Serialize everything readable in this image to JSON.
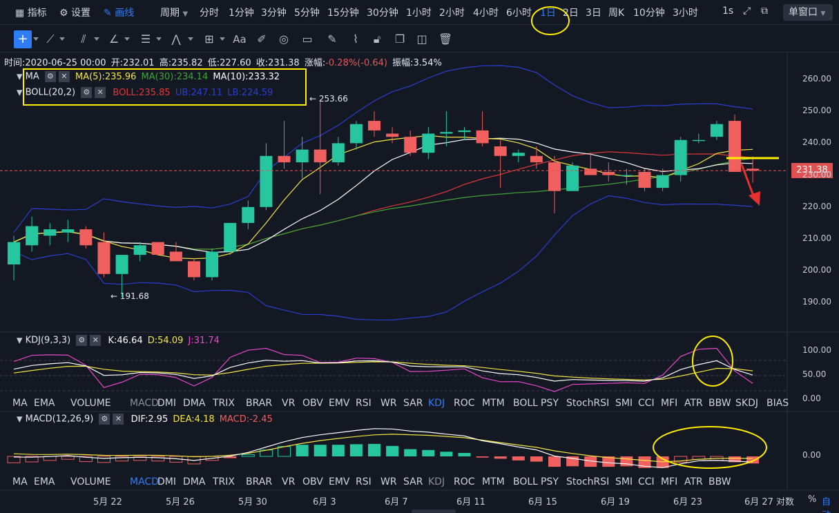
{
  "topbar": {
    "items": [
      {
        "key": "indicator",
        "label": "指标"
      },
      {
        "key": "settings",
        "label": "设置"
      },
      {
        "key": "draw",
        "label": "画线"
      },
      {
        "key": "period",
        "label": "周期"
      }
    ],
    "periods": [
      "分时",
      "1分钟",
      "3分钟",
      "5分钟",
      "15分钟",
      "30分钟",
      "1小时",
      "2小时",
      "4小时",
      "6小时",
      "1日",
      "2日",
      "3日",
      "周K",
      "10分钟",
      "3小时"
    ],
    "active_period": "1日",
    "refresh": "1s",
    "window_mode": "单窗口"
  },
  "info": {
    "time_label": "时间:",
    "time": "2020-06-25 00:00",
    "open_label": "开:",
    "open": "232.01",
    "high_label": "高:",
    "high": "235.82",
    "low_label": "低:",
    "low": "227.60",
    "close_label": "收:",
    "close": "231.38",
    "change_label": "涨幅:",
    "change": "-0.28%(-0.64)",
    "amp_label": "振幅:",
    "amp": "3.54%"
  },
  "ma_legend": {
    "name": "MA",
    "ma5": "MA(5):235.96",
    "ma30": "MA(30):234.14",
    "ma10": "MA(10):233.32"
  },
  "boll_legend": {
    "name": "BOLL(20,2)",
    "boll": "BOLL:235.85",
    "ub": "UB:247.11",
    "lb": "LB:224.59"
  },
  "annotations": {
    "high_mark": "← 253.66",
    "low_mark": "← 191.68",
    "last_price": "231.38"
  },
  "main_axis": [
    "260.00",
    "250.00",
    "240.00",
    "230.00",
    "220.00",
    "210.00",
    "200.00",
    "190.00"
  ],
  "kdj_legend": {
    "name": "KDJ(9,3,3)",
    "k": "K:46.64",
    "d": "D:54.09",
    "j": "J:31.74"
  },
  "kdj_axis": [
    "100.00",
    "50.00",
    "0.00"
  ],
  "macd_legend": {
    "name": "MACD(12,26,9)",
    "dif": "DIF:2.95",
    "dea": "DEA:4.18",
    "macd": "MACD:-2.45"
  },
  "macd_axis": [
    "0.00"
  ],
  "tabs1": [
    "MA",
    "EMA",
    "VOLUME",
    "MACD",
    "DMI",
    "DMA",
    "TRIX",
    "BRAR",
    "VR",
    "OBV",
    "EMV",
    "RSI",
    "WR",
    "SAR",
    "KDJ",
    "ROC",
    "MTM",
    "BOLL",
    "PSY",
    "StochRSI",
    "SMI",
    "CCI",
    "MFI",
    "ATR",
    "BBW",
    "SKDJ",
    "BIAS"
  ],
  "tabs2": [
    "MA",
    "EMA",
    "VOLUME",
    "MACD",
    "DMI",
    "DMA",
    "TRIX",
    "BRAR",
    "VR",
    "OBV",
    "EMV",
    "RSI",
    "WR",
    "SAR",
    "KDJ",
    "ROC",
    "MTM",
    "BOLL",
    "PSY",
    "StochRSI",
    "SMI",
    "CCI",
    "MFI",
    "ATR",
    "BBW"
  ],
  "dates": [
    "5月 22",
    "5月 26",
    "5月 30",
    "6月 3",
    "6月 7",
    "6月 11",
    "6月 15",
    "6月 19",
    "6月 23",
    "6月 27"
  ],
  "footer": {
    "log": "对数",
    "pct": "%",
    "auto": "自动"
  },
  "colors": {
    "up": "#26c6a0",
    "down": "#f0605e",
    "ma5": "#f5e642",
    "ma10": "#ffffff",
    "ma30": "#3da635",
    "boll": "#e0383b",
    "band": "#2a3fd1",
    "highlight": "#ffee00",
    "accent": "#2f7df6"
  },
  "candles": [
    {
      "o": 202,
      "h": 211,
      "l": 197,
      "c": 209
    },
    {
      "o": 208,
      "h": 217,
      "l": 206,
      "c": 214
    },
    {
      "o": 211,
      "h": 215,
      "l": 208,
      "c": 213
    },
    {
      "o": 212,
      "h": 216,
      "l": 209,
      "c": 213
    },
    {
      "o": 213,
      "h": 214,
      "l": 207,
      "c": 208
    },
    {
      "o": 209,
      "h": 212,
      "l": 198,
      "c": 199
    },
    {
      "o": 199,
      "h": 205,
      "l": 191.68,
      "c": 205
    },
    {
      "o": 205,
      "h": 209,
      "l": 203,
      "c": 208
    },
    {
      "o": 209,
      "h": 209,
      "l": 205,
      "c": 205
    },
    {
      "o": 206,
      "h": 209,
      "l": 203,
      "c": 203
    },
    {
      "o": 203,
      "h": 204,
      "l": 197,
      "c": 198
    },
    {
      "o": 198,
      "h": 207,
      "l": 197,
      "c": 206
    },
    {
      "o": 206,
      "h": 215,
      "l": 205,
      "c": 215
    },
    {
      "o": 215,
      "h": 222,
      "l": 213,
      "c": 220
    },
    {
      "o": 220,
      "h": 240,
      "l": 219,
      "c": 236
    },
    {
      "o": 236,
      "h": 247,
      "l": 232,
      "c": 234
    },
    {
      "o": 234,
      "h": 242,
      "l": 229,
      "c": 238
    },
    {
      "o": 238,
      "h": 253.66,
      "l": 224,
      "c": 234
    },
    {
      "o": 234,
      "h": 242,
      "l": 233,
      "c": 240
    },
    {
      "o": 240,
      "h": 247,
      "l": 238,
      "c": 246
    },
    {
      "o": 247,
      "h": 250,
      "l": 242,
      "c": 244
    },
    {
      "o": 243,
      "h": 245,
      "l": 240,
      "c": 242
    },
    {
      "o": 242,
      "h": 244,
      "l": 236,
      "c": 237
    },
    {
      "o": 237,
      "h": 245,
      "l": 235,
      "c": 243
    },
    {
      "o": 243,
      "h": 250,
      "l": 239,
      "c": 243.5
    },
    {
      "o": 243.5,
      "h": 245,
      "l": 241,
      "c": 244
    },
    {
      "o": 244,
      "h": 250,
      "l": 239,
      "c": 240
    },
    {
      "o": 239,
      "h": 241,
      "l": 226,
      "c": 236
    },
    {
      "o": 236,
      "h": 238,
      "l": 234,
      "c": 237
    },
    {
      "o": 236,
      "h": 239,
      "l": 232,
      "c": 234
    },
    {
      "o": 234,
      "h": 236,
      "l": 218,
      "c": 225
    },
    {
      "o": 225,
      "h": 234,
      "l": 225,
      "c": 233
    },
    {
      "o": 232,
      "h": 237,
      "l": 230,
      "c": 230
    },
    {
      "o": 231,
      "h": 234,
      "l": 228,
      "c": 230
    },
    {
      "o": 230,
      "h": 232,
      "l": 227,
      "c": 230
    },
    {
      "o": 231,
      "h": 232,
      "l": 225,
      "c": 226
    },
    {
      "o": 226,
      "h": 232,
      "l": 225,
      "c": 230
    },
    {
      "o": 230,
      "h": 242,
      "l": 228,
      "c": 241
    },
    {
      "o": 241,
      "h": 243,
      "l": 240,
      "c": 241
    },
    {
      "o": 242,
      "h": 247,
      "l": 241,
      "c": 246
    },
    {
      "o": 247,
      "h": 249,
      "l": 231,
      "c": 231
    },
    {
      "o": 232.01,
      "h": 235.82,
      "l": 227.6,
      "c": 231.38
    }
  ],
  "macd_hist": [
    -2.2,
    -1.9,
    -1.4,
    -1.0,
    -1.8,
    -2.1,
    -1.6,
    -1.4,
    -1.6,
    -2.0,
    -2.6,
    -1.4,
    -0.6,
    0.6,
    2.2,
    3.4,
    4.0,
    4.0,
    4.0,
    4.2,
    4.3,
    3.6,
    2.5,
    2.2,
    1.6,
    1.2,
    -0.4,
    -0.8,
    -1.4,
    -1.8,
    -3.6,
    -3.4,
    -3.6,
    -3.6,
    -3.4,
    -4.0,
    -4.0,
    -2.0,
    -1.0,
    -1.4,
    -2.0,
    -2.45
  ]
}
